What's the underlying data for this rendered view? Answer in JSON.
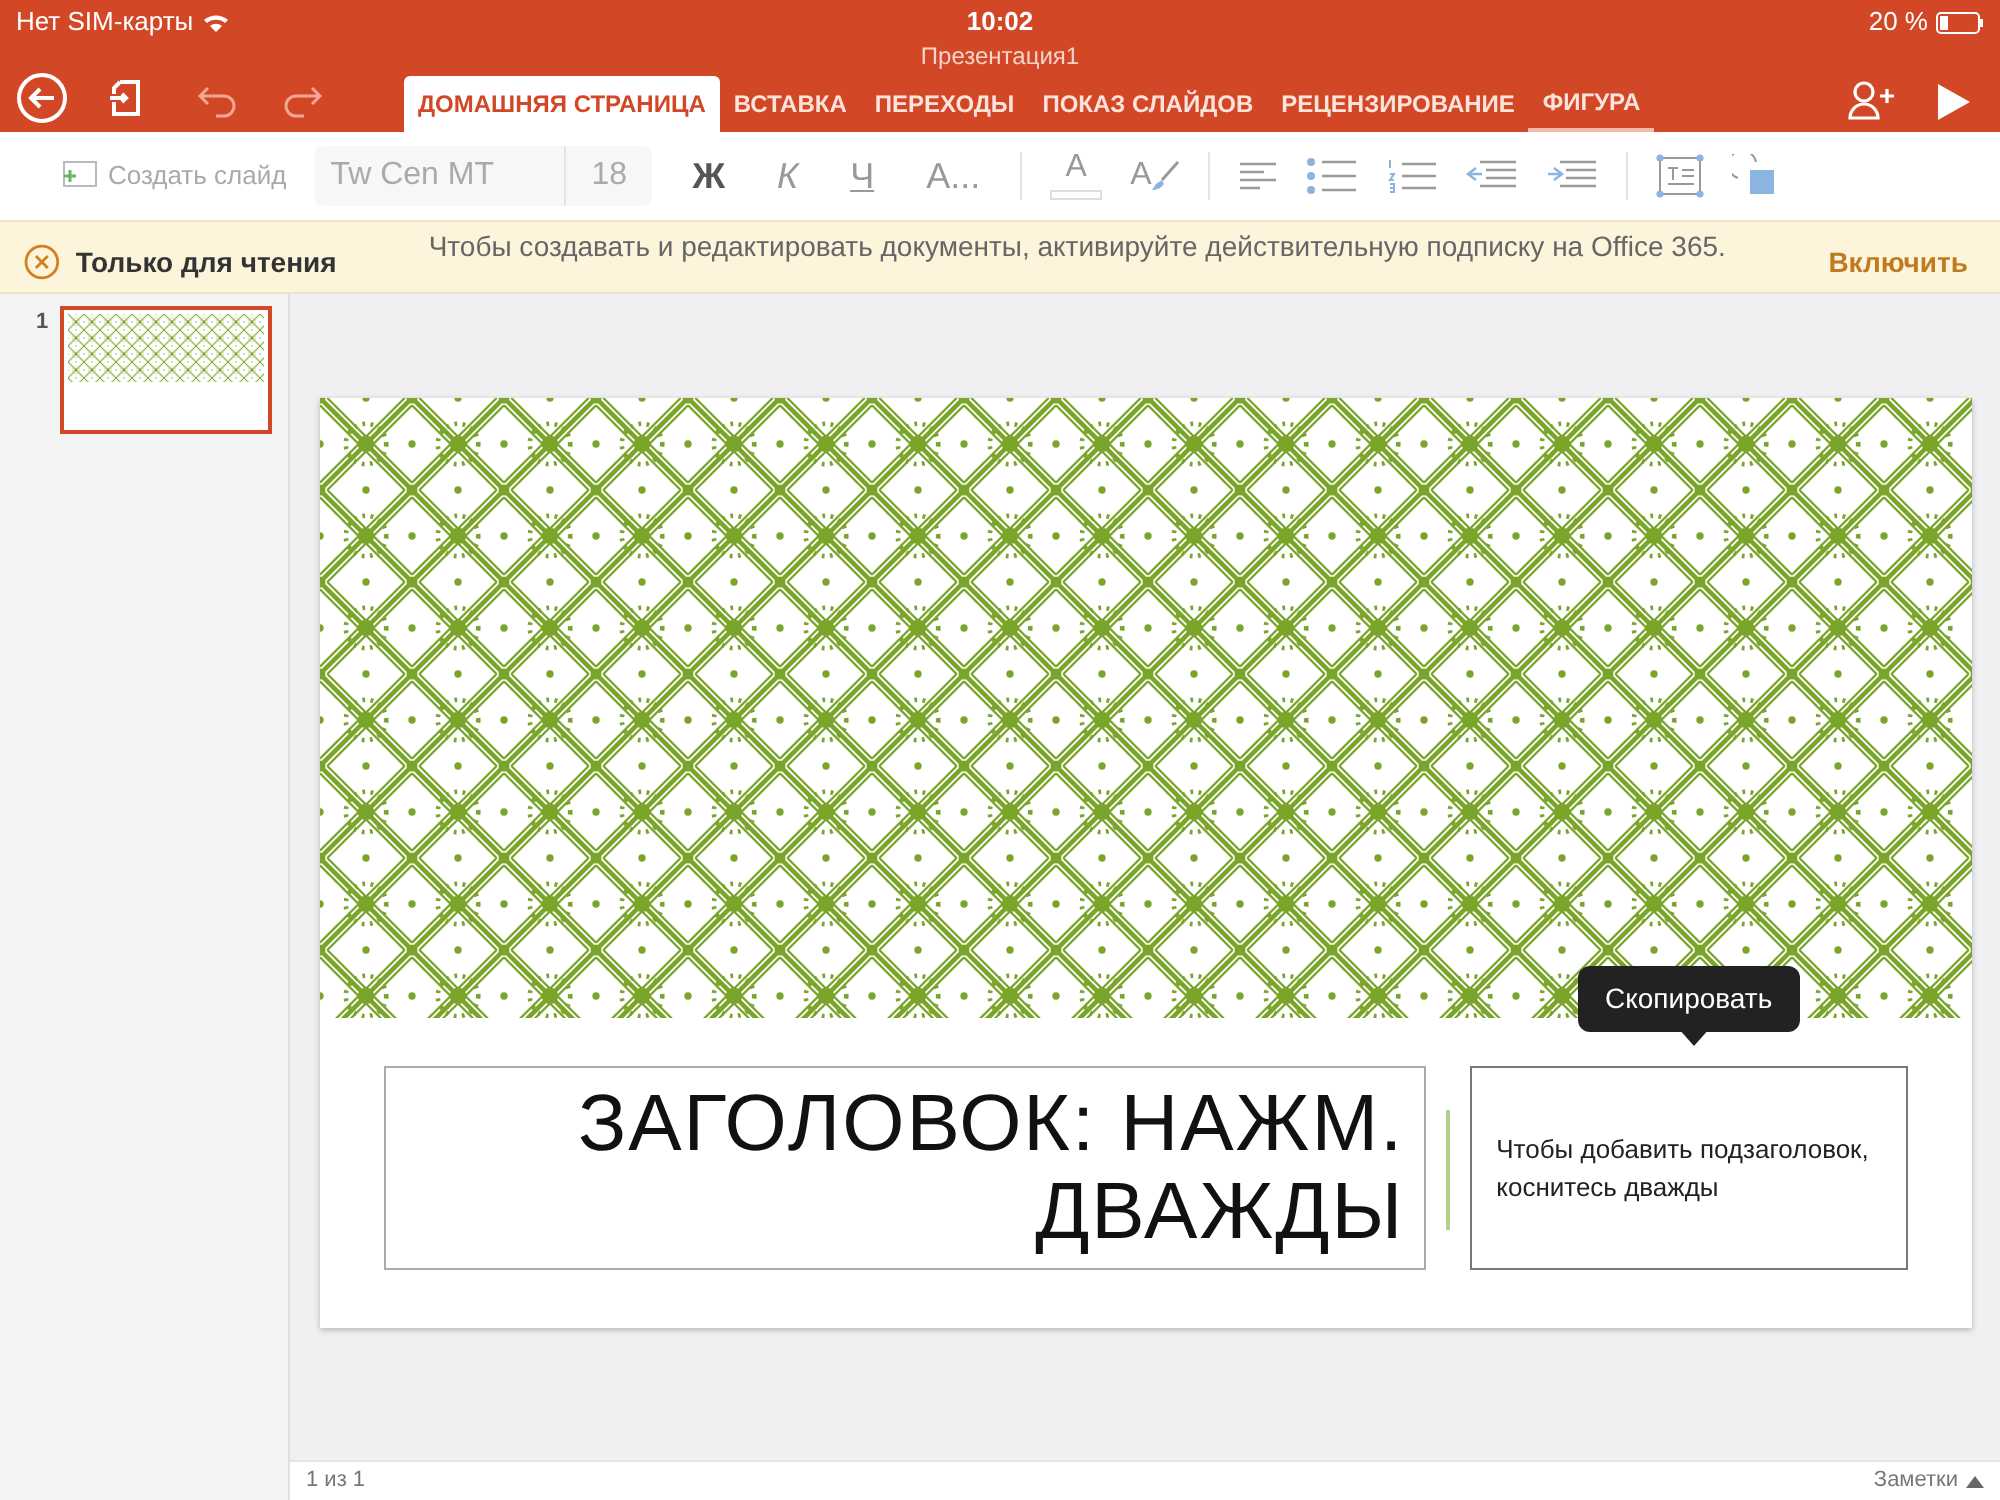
{
  "status_bar": {
    "carrier": "Нет SIM-карты",
    "time": "10:02",
    "battery": "20 %"
  },
  "window": {
    "title": "Презентация1"
  },
  "tabs": [
    {
      "label": "ДОМАШНЯЯ СТРАНИЦА",
      "selected": true
    },
    {
      "label": "ВСТАВКА",
      "selected": false
    },
    {
      "label": "ПЕРЕХОДЫ",
      "selected": false
    },
    {
      "label": "ПОКАЗ СЛАЙДОВ",
      "selected": false
    },
    {
      "label": "РЕЦЕНЗИРОВАНИЕ",
      "selected": false
    },
    {
      "label": "ФИГУРА",
      "selected": false,
      "kind": "contextual"
    }
  ],
  "toolbar": {
    "new_slide": "Создать слайд",
    "font": "Tw Cen MT",
    "font_size": "18",
    "format_buttons": [
      {
        "kind": "bold",
        "label": "Ж"
      },
      {
        "kind": "italic",
        "label": "К"
      },
      {
        "kind": "underline",
        "label": "Ч"
      },
      {
        "kind": "more",
        "label": "A..."
      }
    ],
    "font_color": "A",
    "highlight": "A"
  },
  "notice": {
    "title": "Только для чтения",
    "message": "Чтобы создавать и редактировать документы, активируйте действительную подписку на Office 365.",
    "action": "Включить"
  },
  "slides": [
    {
      "number": "1",
      "selected": true
    }
  ],
  "slide": {
    "title": "ЗАГОЛОВОК: НАЖМ. ДВАЖДЫ",
    "subtitle": "Чтобы добавить подзаголовок, коснитесь дважды",
    "tooltip": "Скопировать"
  },
  "footer": {
    "page": "1 из 1",
    "notes": "Заметки"
  }
}
